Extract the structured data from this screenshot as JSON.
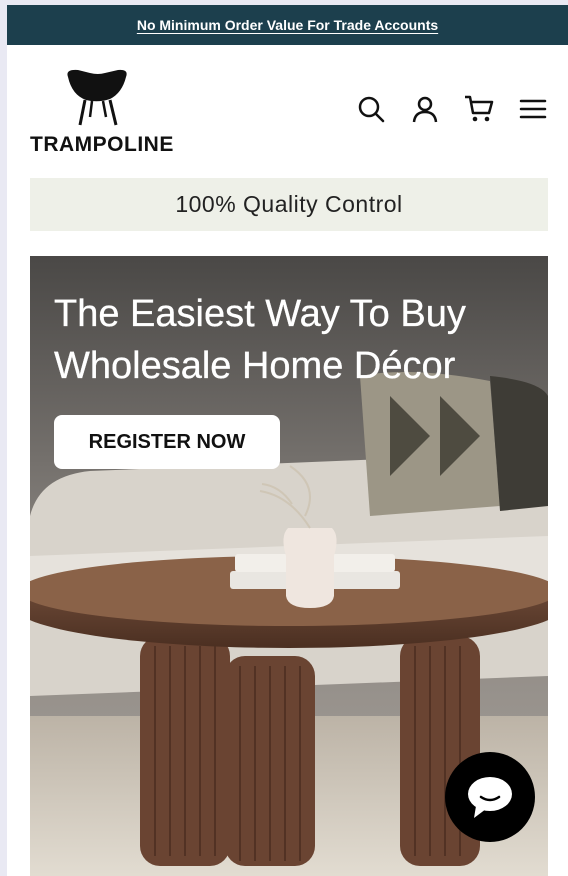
{
  "announcement": {
    "text": "No Minimum Order Value For Trade Accounts"
  },
  "header": {
    "logo_text": "TRAMPOLINE",
    "icons": [
      "search-icon",
      "account-icon",
      "cart-icon",
      "menu-icon"
    ]
  },
  "promo_bar": {
    "text": "100% Quality Control"
  },
  "hero": {
    "title": "The Easiest Way To Buy Wholesale Home Décor",
    "cta_label": "REGISTER NOW"
  },
  "chat": {
    "icon": "chat-bubble-icon"
  },
  "colors": {
    "topbar": "#1c3f4d",
    "promo_bg": "#eef0e8",
    "chat": "#000000"
  }
}
